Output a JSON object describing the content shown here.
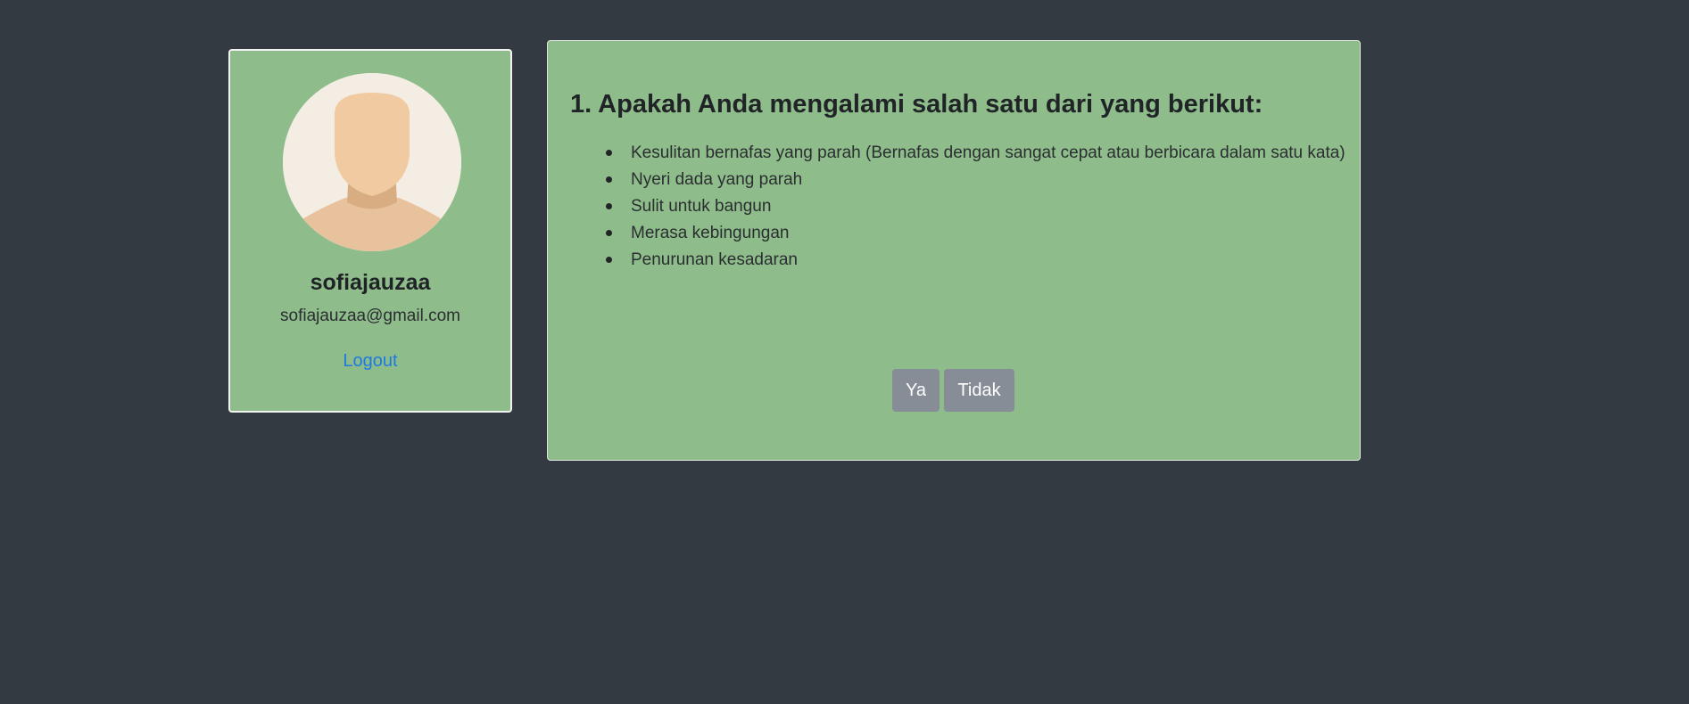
{
  "profile": {
    "username": "sofiajauzaa",
    "email": "sofiajauzaa@gmail.com",
    "logout_label": "Logout",
    "avatar_icon": "user-avatar-icon"
  },
  "question": {
    "title": "1. Apakah Anda mengalami salah satu dari yang berikut:",
    "items": [
      "Kesulitan bernafas yang parah (Bernafas dengan sangat cepat atau berbicara dalam satu kata)",
      "Nyeri dada yang parah",
      "Sulit untuk bangun",
      "Merasa kebingungan",
      "Penurunan kesadaran"
    ],
    "yes_label": "Ya",
    "no_label": "Tidak"
  },
  "colors": {
    "page_background": "#343a42",
    "card_background": "#8fbc8b",
    "link": "#1f7ae0",
    "button": "#868d96"
  }
}
